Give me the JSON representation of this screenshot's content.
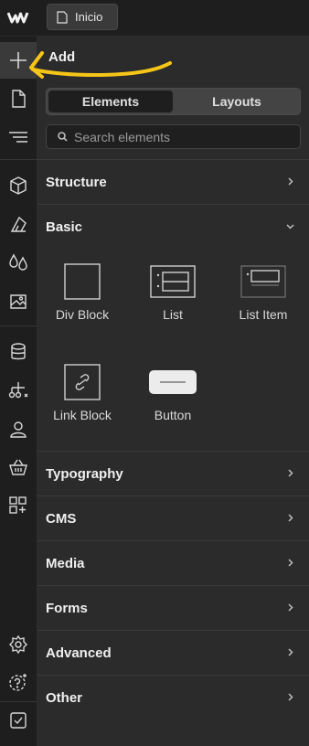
{
  "header": {
    "page_label": "Inicio"
  },
  "panel": {
    "title": "Add",
    "tabs": [
      {
        "label": "Elements",
        "active": true
      },
      {
        "label": "Layouts",
        "active": false
      }
    ],
    "search_placeholder": "Search elements",
    "sections": {
      "structure": "Structure",
      "basic": "Basic",
      "typography": "Typography",
      "cms": "CMS",
      "media": "Media",
      "forms": "Forms",
      "advanced": "Advanced",
      "other": "Other"
    },
    "basic_items": {
      "div_block": "Div Block",
      "list": "List",
      "list_item": "List Item",
      "link_block": "Link Block",
      "button": "Button"
    }
  },
  "rail_icons": [
    "plus-icon",
    "page-icon",
    "navigator-icon",
    "box-icon",
    "style-icon",
    "color-drops-icon",
    "assets-image-icon",
    "database-icon",
    "logic-flow-icon",
    "user-icon",
    "basket-icon",
    "apps-icon",
    "settings-gear-icon",
    "help-icon",
    "checkbox-icon"
  ],
  "colors": {
    "annotation": "#f5c518",
    "panel_bg": "#2b2b2b",
    "rail_bg": "#1e1e1e"
  }
}
